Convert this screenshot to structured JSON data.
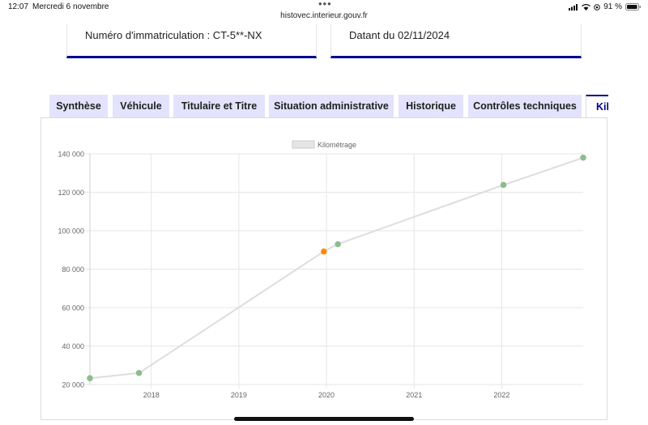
{
  "status_bar": {
    "time": "12:07",
    "date": "Mercredi 6 novembre",
    "battery": "91 %"
  },
  "browser": {
    "url": "histovec.interieur.gouv.fr"
  },
  "cards": {
    "plate": "Numéro d'immatriculation : CT-5**-NX",
    "dated": "Datant du 02/11/2024"
  },
  "tabs": [
    {
      "label": "Synthèse"
    },
    {
      "label": "Véhicule"
    },
    {
      "label": "Titulaire et Titre"
    },
    {
      "label": "Situation administrative"
    },
    {
      "label": "Historique"
    },
    {
      "label": "Contrôles techniques"
    },
    {
      "label": "Kil"
    }
  ],
  "colors": {
    "accent": "#000091",
    "tab_bg": "#e3e3fd",
    "point_green": "#8fbc8f",
    "point_orange": "#ff8c00",
    "line": "#dddddd"
  },
  "chart_data": {
    "type": "line",
    "legend": "Kilométrage",
    "legend_position": "top-center",
    "grid": true,
    "xlim": [
      2017.3,
      2022.93
    ],
    "ylim": [
      20000,
      140000
    ],
    "x_ticks": [
      "2018",
      "2019",
      "2020",
      "2021",
      "2022"
    ],
    "y_ticks": [
      "20 000",
      "40 000",
      "60 000",
      "80 000",
      "100 000",
      "120 000",
      "140 000"
    ],
    "points": [
      {
        "x": 2017.3,
        "y": 23300,
        "color": "green"
      },
      {
        "x": 2017.86,
        "y": 26000,
        "color": "green"
      },
      {
        "x": 2019.97,
        "y": 89200,
        "color": "orange"
      },
      {
        "x": 2020.13,
        "y": 93000,
        "color": "green"
      },
      {
        "x": 2022.02,
        "y": 123800,
        "color": "green"
      },
      {
        "x": 2022.93,
        "y": 138000,
        "color": "green"
      }
    ]
  }
}
